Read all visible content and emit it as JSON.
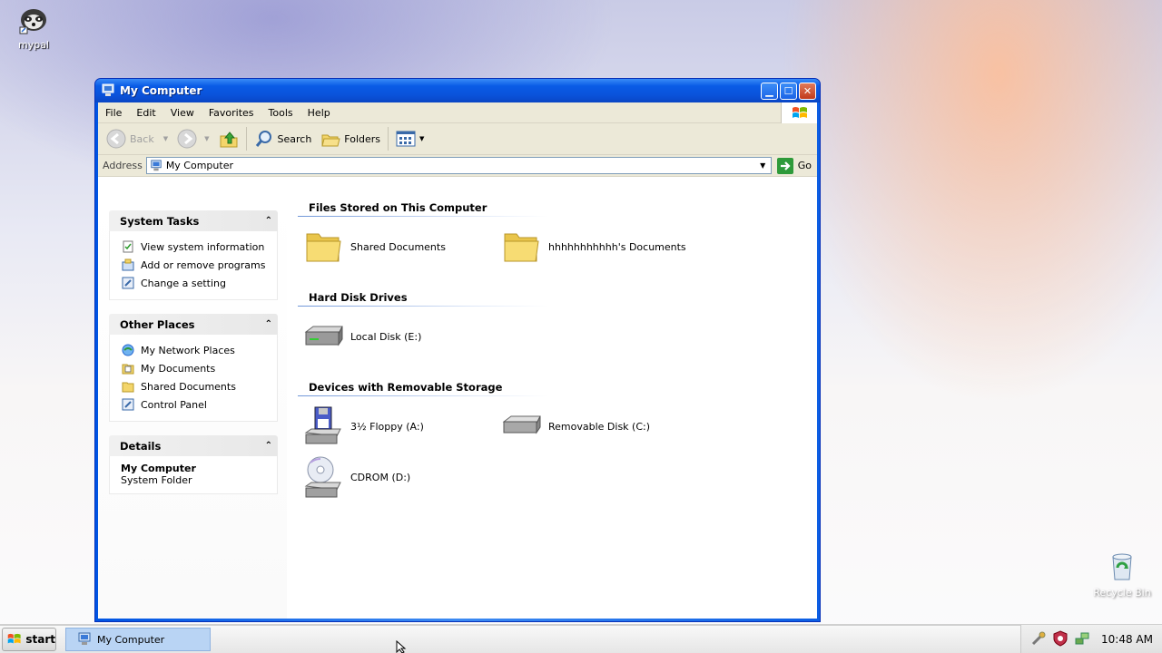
{
  "desktop": {
    "icons": [
      {
        "label": "mypal",
        "icon": "mypal-raccoon-icon"
      },
      {
        "label": "Recycle Bin",
        "icon": "recycle-bin-icon"
      }
    ]
  },
  "window": {
    "title": "My Computer",
    "menu": [
      "File",
      "Edit",
      "View",
      "Favorites",
      "Tools",
      "Help"
    ],
    "toolbar": {
      "back": "Back",
      "search": "Search",
      "folders": "Folders"
    },
    "address": {
      "label": "Address",
      "value": "My Computer",
      "go": "Go"
    }
  },
  "sidebar": {
    "system_tasks": {
      "title": "System Tasks",
      "items": [
        "View system information",
        "Add or remove programs",
        "Change a setting"
      ]
    },
    "other_places": {
      "title": "Other Places",
      "items": [
        "My Network Places",
        "My Documents",
        "Shared Documents",
        "Control Panel"
      ]
    },
    "details": {
      "title": "Details",
      "name": "My Computer",
      "type": "System Folder"
    }
  },
  "main": {
    "groups": [
      {
        "title": "Files Stored on This Computer",
        "items": [
          "Shared Documents",
          "hhhhhhhhhhh's Documents"
        ]
      },
      {
        "title": "Hard Disk Drives",
        "items": [
          "Local Disk (E:)"
        ]
      },
      {
        "title": "Devices with Removable Storage",
        "items": [
          "3½ Floppy (A:)",
          "Removable Disk (C:)",
          "CDROM (D:)"
        ]
      }
    ]
  },
  "taskbar": {
    "start": "start",
    "task": "My Computer",
    "clock": "10:48 AM"
  },
  "colors": {
    "title_blue": "#0a52da",
    "taskitem": "#b9d4f4",
    "folder_yellow": "#f5d95e"
  }
}
